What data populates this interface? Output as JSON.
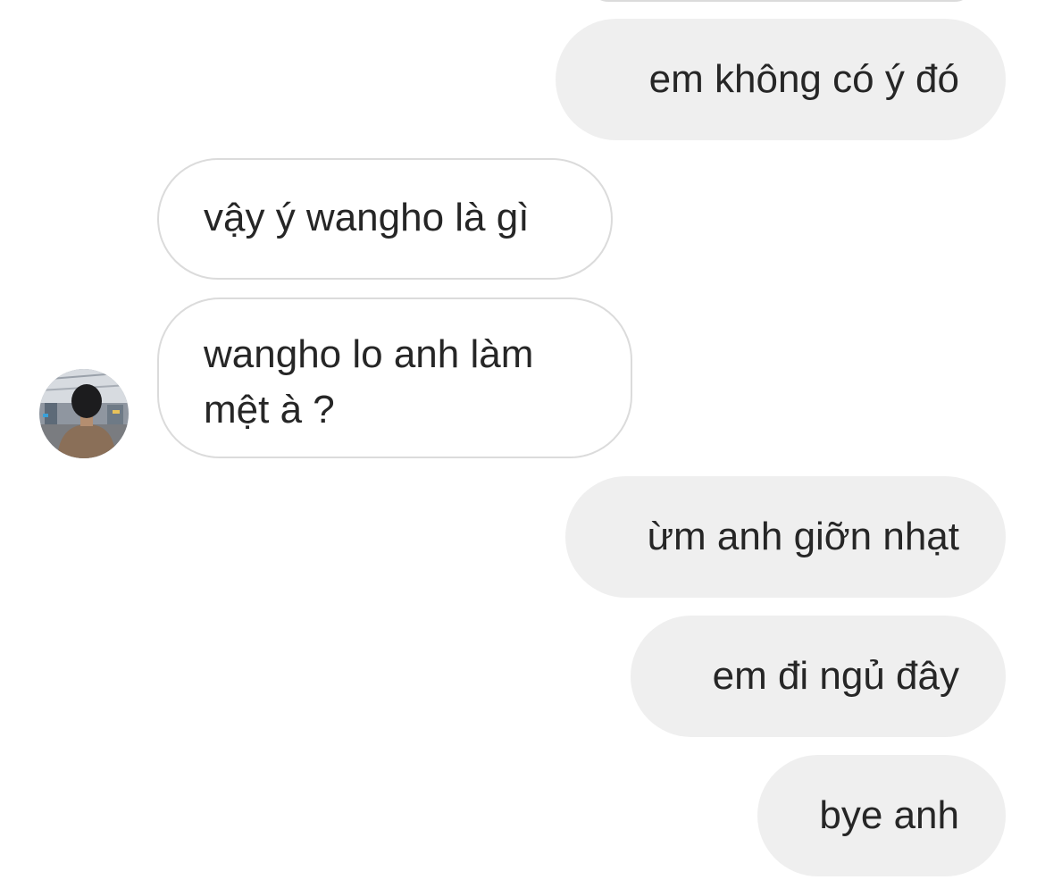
{
  "conversation": {
    "messages": [
      {
        "direction": "sent",
        "lines": [
          "em không có ý đó"
        ]
      },
      {
        "direction": "received",
        "lines": [
          "vậy ý wangho là gì"
        ]
      },
      {
        "direction": "received",
        "lines": [
          "wangho lo anh làm",
          "mệt à ?"
        ]
      },
      {
        "direction": "sent",
        "lines": [
          "ừm anh giỡn nhạt"
        ]
      },
      {
        "direction": "sent",
        "lines": [
          "em đi ngủ đây"
        ]
      },
      {
        "direction": "sent",
        "lines": [
          "bye anh"
        ]
      }
    ],
    "contact_avatar": {
      "icon": "profile-photo-person-from-behind"
    }
  },
  "colors": {
    "sent_bubble": "#efefef",
    "received_border": "#dbdbdb",
    "text": "#262626",
    "background": "#ffffff"
  }
}
